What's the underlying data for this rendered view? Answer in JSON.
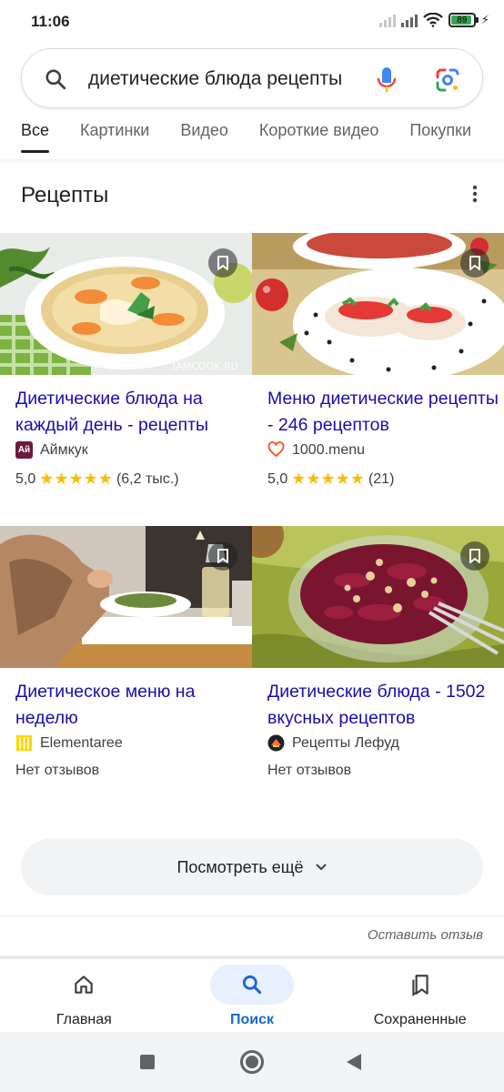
{
  "status_bar": {
    "time": "11:06",
    "battery": "89"
  },
  "search": {
    "query": "диетические блюда рецепты"
  },
  "tabs": [
    {
      "label": "Все"
    },
    {
      "label": "Картинки"
    },
    {
      "label": "Видео"
    },
    {
      "label": "Короткие видео"
    },
    {
      "label": "Покупки"
    }
  ],
  "section": {
    "title": "Рецепты"
  },
  "cards": [
    {
      "title": "Диетические блюда на каждый день - рецепты",
      "source": "Аймкук",
      "source_icon_text": "Ай",
      "rating": "5,0",
      "reviews": "(6,2 тыс.)",
      "stars": "★★★★★"
    },
    {
      "title": "Меню диетические рецепты - 246 рецептов",
      "source": "1000.menu",
      "rating": "5,0",
      "reviews": "(21)",
      "stars": "★★★★★"
    },
    {
      "title": "Диетическое меню на неделю",
      "source": "Elementaree",
      "no_reviews": "Нет отзывов"
    },
    {
      "title": "Диетические блюда - 1502 вкусных рецептов",
      "source": "Рецепты Лефуд",
      "no_reviews": "Нет отзывов"
    }
  ],
  "more_button": {
    "label": "Посмотреть ещё"
  },
  "feedback": {
    "label": "Оставить отзыв"
  },
  "bottom_nav": [
    {
      "label": "Главная",
      "icon": "home-icon"
    },
    {
      "label": "Поиск",
      "icon": "search-icon"
    },
    {
      "label": "Сохраненные",
      "icon": "bookmarks-icon"
    }
  ],
  "colors": {
    "link": "#1a0dab",
    "star": "#fbbc04",
    "active_nav": "#1967d2"
  }
}
